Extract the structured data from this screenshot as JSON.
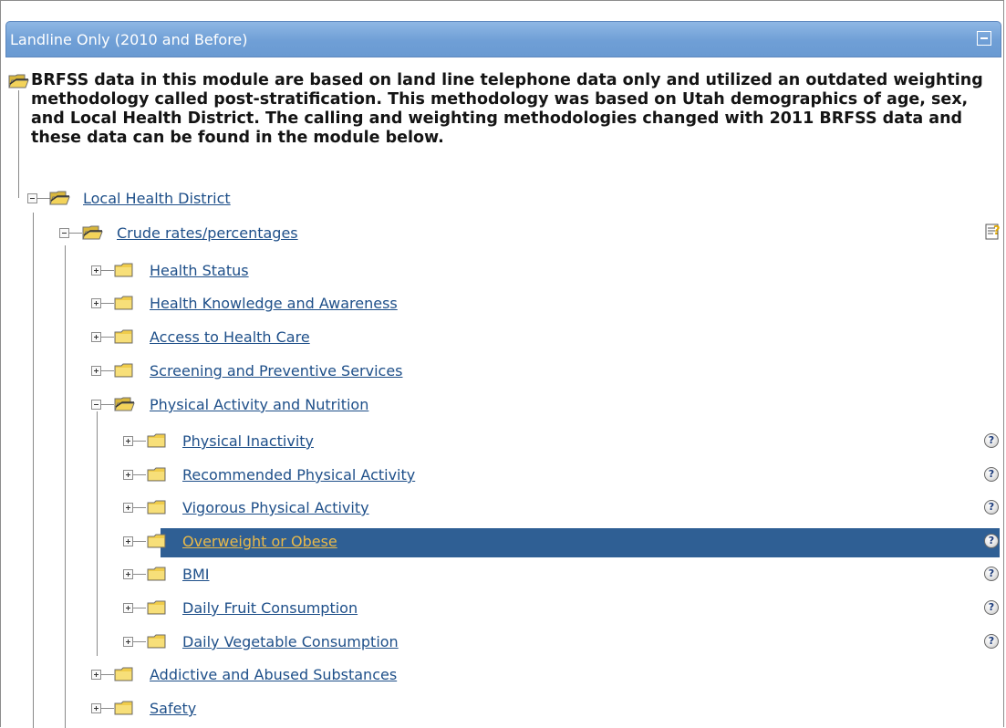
{
  "panel": {
    "title": "Landline Only (2010 and Before)",
    "intro": "BRFSS data in this module are based on land line telephone data only and utilized an outdated weighting methodology called post-stratification. This methodology was based on Utah demographics of age, sex, and Local Health District. The calling and weighting methodologies changed with 2011 BRFSS data and these data can be found in the module below."
  },
  "tree": {
    "level1": {
      "label": "Local Health District"
    },
    "level2": {
      "label": "Crude rates/percentages"
    },
    "categories": [
      {
        "label": "Health Status"
      },
      {
        "label": "Health Knowledge and Awareness"
      },
      {
        "label": "Access to Health Care"
      },
      {
        "label": "Screening and Preventive Services"
      },
      {
        "label": "Physical Activity and Nutrition"
      }
    ],
    "subitems": [
      {
        "label": "Physical Inactivity"
      },
      {
        "label": "Recommended Physical Activity"
      },
      {
        "label": "Vigorous Physical Activity"
      },
      {
        "label": "Overweight or Obese",
        "selected": true
      },
      {
        "label": "BMI"
      },
      {
        "label": "Daily Fruit Consumption"
      },
      {
        "label": "Daily Vegetable Consumption"
      }
    ],
    "after": [
      {
        "label": "Addictive and Abused Substances"
      },
      {
        "label": "Safety"
      }
    ]
  },
  "icons": {
    "help": "?",
    "colors": {
      "header": "#6f9fd6",
      "selected": "#2f5f94",
      "link": "#1e4f89",
      "selected_link": "#e9b949",
      "folder": "#f3d35a"
    }
  }
}
